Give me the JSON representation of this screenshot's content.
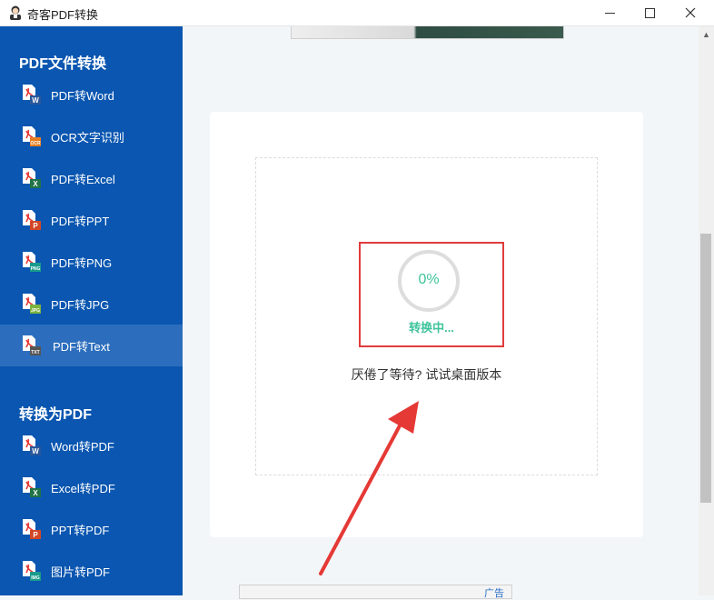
{
  "window": {
    "title": "奇客PDF转换",
    "icons": {
      "app": "app-logo-icon",
      "minimize": "minimize-icon",
      "maximize": "maximize-icon",
      "close": "close-icon"
    }
  },
  "sidebar": {
    "section1_title": "PDF文件转换",
    "section1_items": [
      {
        "label": "PDF转Word",
        "icon": "pdf-to-word-icon",
        "badge": "W",
        "badge_color": "#2b579a"
      },
      {
        "label": "OCR文字识别",
        "icon": "ocr-icon",
        "badge": "OCR",
        "badge_color": "#e67e22"
      },
      {
        "label": "PDF转Excel",
        "icon": "pdf-to-excel-icon",
        "badge": "X",
        "badge_color": "#217346"
      },
      {
        "label": "PDF转PPT",
        "icon": "pdf-to-ppt-icon",
        "badge": "P",
        "badge_color": "#d24726"
      },
      {
        "label": "PDF转PNG",
        "icon": "pdf-to-png-icon",
        "badge": "PNG",
        "badge_color": "#1a9b8c"
      },
      {
        "label": "PDF转JPG",
        "icon": "pdf-to-jpg-icon",
        "badge": "JPG",
        "badge_color": "#7cb342"
      },
      {
        "label": "PDF转Text",
        "icon": "pdf-to-text-icon",
        "badge": "TXT",
        "badge_color": "#555555",
        "active": true
      }
    ],
    "section2_title": "转换为PDF",
    "section2_items": [
      {
        "label": "Word转PDF",
        "icon": "word-to-pdf-icon",
        "badge": "W",
        "badge_color": "#2b579a"
      },
      {
        "label": "Excel转PDF",
        "icon": "excel-to-pdf-icon",
        "badge": "X",
        "badge_color": "#217346"
      },
      {
        "label": "PPT转PDF",
        "icon": "ppt-to-pdf-icon",
        "badge": "P",
        "badge_color": "#d24726"
      },
      {
        "label": "图片转PDF",
        "icon": "image-to-pdf-icon",
        "badge": "IMG",
        "badge_color": "#1a9b8c"
      }
    ]
  },
  "main": {
    "progress": {
      "percent_text": "0%",
      "value": 0
    },
    "status": "转换中...",
    "hint": "厌倦了等待? 试试桌面版本",
    "bottom_ad_label": "广告",
    "colors": {
      "progress": "#3fc49b",
      "highlight": "#e03b3b",
      "arrow": "#e53935",
      "sidebar": "#0a56b0"
    }
  }
}
